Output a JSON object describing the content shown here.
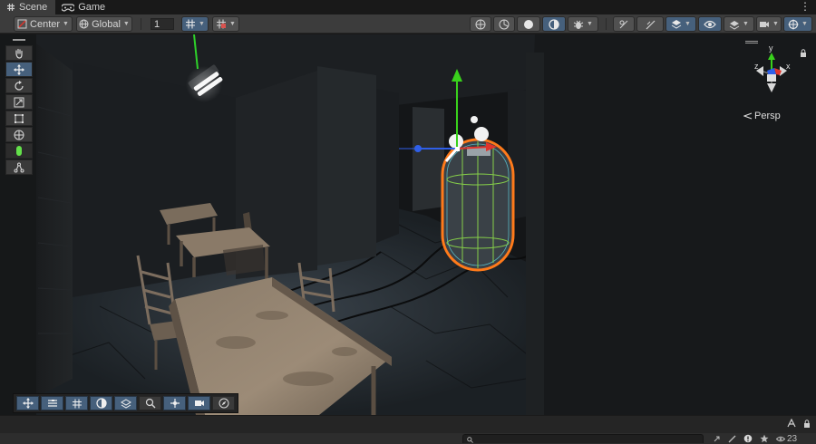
{
  "tabs": [
    {
      "label": "Scene",
      "icon": "grid-icon",
      "active": true
    },
    {
      "label": "Game",
      "icon": "gamepad-icon",
      "active": false
    }
  ],
  "toolbar": {
    "pivot_mode": "Center",
    "pivot_rotation": "Global",
    "grid_snap_value": "1"
  },
  "tools": [
    {
      "name": "hand-tool",
      "icon": "hand-icon",
      "active": false
    },
    {
      "name": "move-tool",
      "icon": "move-icon",
      "active": true
    },
    {
      "name": "rotate-tool",
      "icon": "rotate-icon",
      "active": false
    },
    {
      "name": "scale-tool",
      "icon": "scale-icon",
      "active": false
    },
    {
      "name": "rect-tool",
      "icon": "rect-icon",
      "active": false
    },
    {
      "name": "transform-tool",
      "icon": "transform-icon",
      "active": false
    },
    {
      "name": "collider-tool",
      "icon": "capsule-icon",
      "active": false
    },
    {
      "name": "custom-tool",
      "icon": "bone-icon",
      "active": false
    }
  ],
  "gizmo": {
    "y_label": "y",
    "z_label": "z",
    "x_label": "x",
    "projection": "Persp"
  },
  "status": {
    "hidden_count": "23"
  },
  "colors": {
    "selection": "#ff7a1a",
    "axis_x": "#e0342c",
    "axis_y": "#39d11c",
    "axis_z": "#2f5fe8",
    "toolbar_active": "#46607c"
  }
}
